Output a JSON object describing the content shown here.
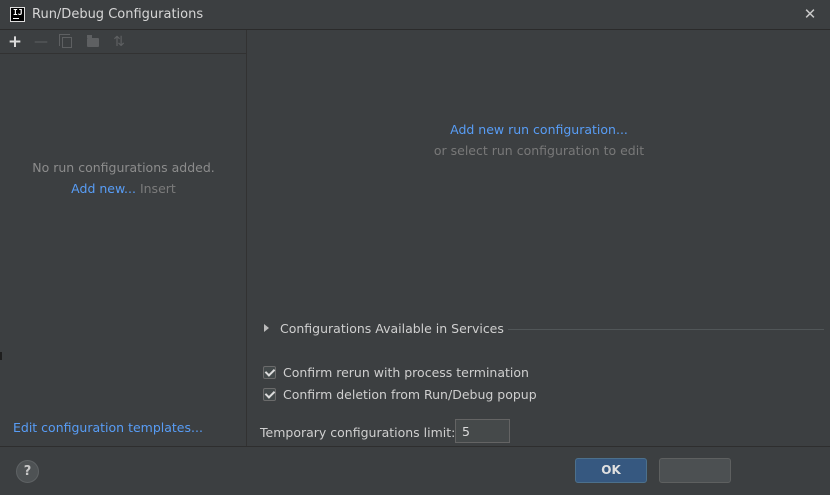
{
  "window": {
    "title": "Run/Debug Configurations",
    "app_icon_text": "IJ"
  },
  "left_panel": {
    "toolbar": {
      "add_icon": "plus-icon",
      "remove_icon": "minus-icon",
      "copy_icon": "copy-icon",
      "folder_icon": "folder-icon",
      "sort_icon": "sort-icon"
    },
    "empty_message": "No run configurations added.",
    "add_new_link": "Add new...",
    "insert_hint": "Insert",
    "edit_templates_link": "Edit configuration templates..."
  },
  "right_panel": {
    "add_new_run_link": "Add new run configuration...",
    "or_select_text": "or select run configuration to edit",
    "services_label": "Configurations Available in Services",
    "confirm_rerun_label": "Confirm rerun with process termination",
    "confirm_rerun_checked": true,
    "confirm_deletion_label": "Confirm deletion from Run/Debug popup",
    "confirm_deletion_checked": true,
    "temp_limit_label": "Temporary configurations limit:",
    "temp_limit_value": "5"
  },
  "buttons": {
    "help": "?",
    "ok": "OK"
  },
  "colors": {
    "background": "#3c3f41",
    "link": "#589df6",
    "ok_button": "#365880"
  }
}
